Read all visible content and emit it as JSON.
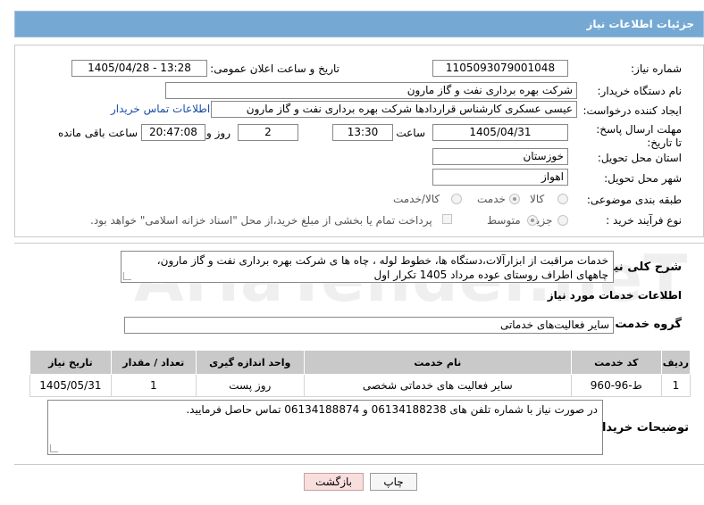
{
  "header": {
    "title": "جزئیات اطلاعات نیاز"
  },
  "fields": {
    "need_number": {
      "label": "شماره نیاز:",
      "value": "1105093079001048"
    },
    "announce_datetime": {
      "label": "تاریخ و ساعت اعلان عمومی:",
      "value": "1405/04/28 - 13:28"
    },
    "buyer_org": {
      "label": "نام دستگاه خریدار:",
      "value": "شرکت بهره برداری نفت و گاز مارون"
    },
    "requester": {
      "label": "ایجاد کننده درخواست:",
      "value": "عیسی عسکری کارشناس قراردادها شرکت بهره برداری نفت و گاز مارون"
    },
    "buyer_contact_link": "اطلاعات تماس خریدار",
    "deadline": {
      "label": "مهلت ارسال پاسخ: تا تاریخ:",
      "date": "1405/04/31",
      "time_label": "ساعت",
      "time": "13:30",
      "days": "2",
      "days_label": "روز و",
      "remaining": "20:47:08",
      "remaining_label": "ساعت باقی مانده"
    },
    "province": {
      "label": "استان محل تحویل:",
      "value": "خوزستان"
    },
    "city": {
      "label": "شهر محل تحویل:",
      "value": "اهواز"
    },
    "category": {
      "label": "طبقه بندی موضوعی:",
      "options": [
        "کالا",
        "خدمت",
        "کالا/خدمت"
      ],
      "selected": "خدمت"
    },
    "process_type": {
      "label": "نوع فرآیند خرید :",
      "options": [
        "جزیی",
        "متوسط"
      ],
      "selected": "جزیی",
      "payment_note": "پرداخت تمام یا بخشی از مبلغ خرید،از محل \"اسناد خزانه اسلامی\" خواهد بود."
    }
  },
  "description": {
    "label": "شرح کلی نیاز:",
    "value": "خدمات مراقبت از ابزارآلات،دستگاه ها، خطوط لوله ، چاه ها ی شرکت بهره برداری نفت و گاز مارون، چاههای اطراف روستای عوده مرداد 1405 تکرار اول"
  },
  "services_section": {
    "title": "اطلاعات خدمات مورد نیاز",
    "group_label": "گروه خدمت:",
    "group_value": "سایر فعالیت‌های خدماتی"
  },
  "table": {
    "headers": [
      "ردیف",
      "کد خدمت",
      "نام خدمت",
      "واحد اندازه گیری",
      "تعداد / مقدار",
      "تاریخ نیاز"
    ],
    "rows": [
      [
        "1",
        "ط-96-960",
        "سایر فعالیت های خدماتی شخصی",
        "روز پست",
        "1",
        "1405/05/31"
      ]
    ]
  },
  "buyer_notes": {
    "label": "توضیحات خریدار:",
    "value": "در صورت نیاز با شماره تلفن های 06134188238 و 06134188874 تماس حاصل فرمایید."
  },
  "buttons": {
    "print": "چاپ",
    "back": "بازگشت"
  },
  "watermark": "AriaTender.neT"
}
